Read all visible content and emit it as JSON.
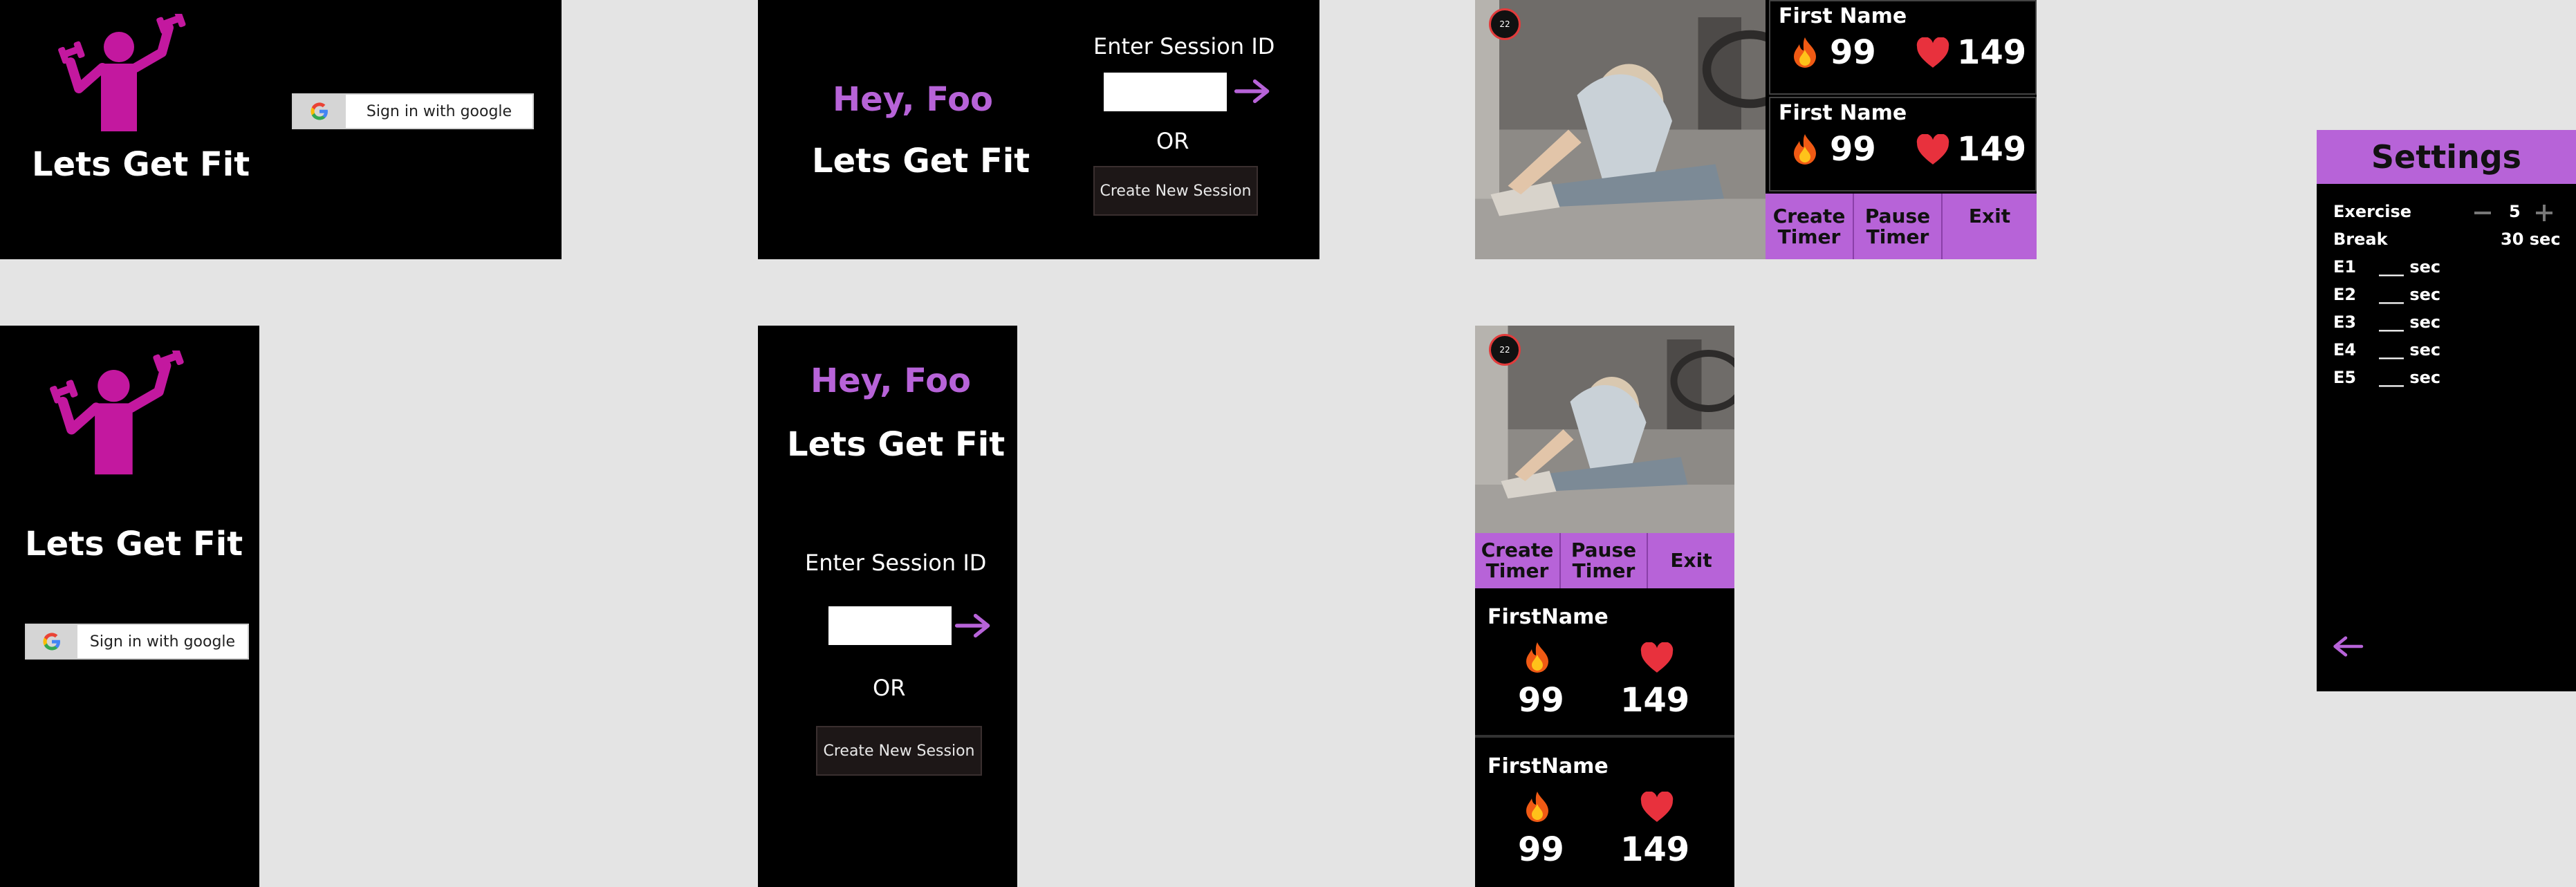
{
  "app": {
    "title": "Lets Get Fit",
    "greeting": "Hey, Foo",
    "accent": "#b763d8",
    "logo_color": "#c3189f"
  },
  "signin": {
    "google_label": "Sign in with google",
    "google_icon": "google-g-icon"
  },
  "session": {
    "enter_label": "Enter Session ID",
    "input_value": "",
    "or_label": "OR",
    "create_label": "Create New Session",
    "submit_icon": "arrow-right-icon"
  },
  "timer": {
    "badge": "22"
  },
  "participants_wide": [
    {
      "name": "First Name",
      "calories": "99",
      "heart_rate": "149"
    },
    {
      "name": "First Name",
      "calories": "99",
      "heart_rate": "149"
    }
  ],
  "participants_tall": [
    {
      "name": "FirstName",
      "calories": "99",
      "heart_rate": "149"
    },
    {
      "name": "FirstName",
      "calories": "99",
      "heart_rate": "149"
    }
  ],
  "controls": {
    "create_timer": [
      "Create",
      "Timer"
    ],
    "pause_timer": [
      "Pause",
      "Timer"
    ],
    "exit": "Exit"
  },
  "settings": {
    "title": "Settings",
    "exercise_label": "Exercise",
    "exercise_count": "5",
    "minus_icon": "minus-icon",
    "plus_icon": "plus-icon",
    "break_label": "Break",
    "break_value": "30 sec",
    "exercises": [
      {
        "label": "E1",
        "value": "___ sec"
      },
      {
        "label": "E2",
        "value": "___ sec"
      },
      {
        "label": "E3",
        "value": "___ sec"
      },
      {
        "label": "E4",
        "value": "___ sec"
      },
      {
        "label": "E5",
        "value": "___ sec"
      }
    ],
    "back_icon": "arrow-left-icon"
  }
}
